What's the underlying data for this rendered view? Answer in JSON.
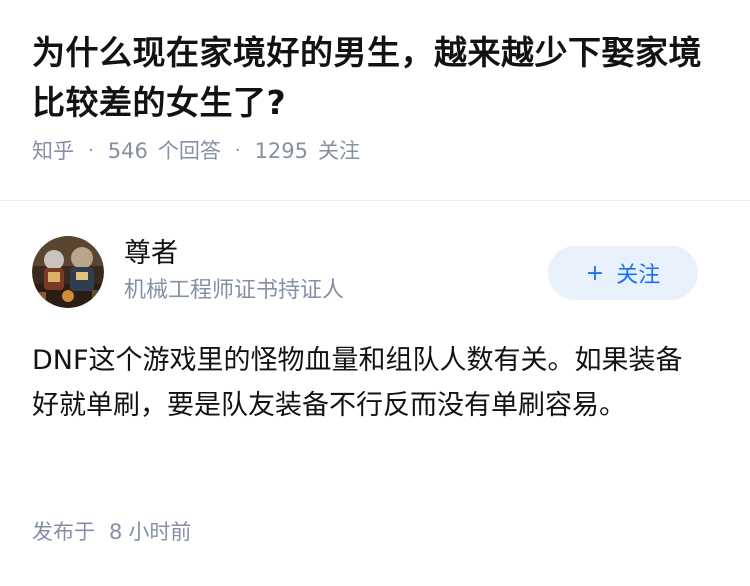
{
  "question": {
    "title": "为什么现在家境好的男生，越来越少下娶家境比较差的女生了?",
    "source": "知乎",
    "answer_count": "546",
    "answer_unit": "个回答",
    "follower_count": "1295",
    "follower_unit": "关注"
  },
  "answer": {
    "author": {
      "name": "尊者",
      "badge": "机械工程师证书持证人",
      "avatar_icon": "avatar-image"
    },
    "follow_button": {
      "plus": "+",
      "label": "关注"
    },
    "content": "DNF这个游戏里的怪物血量和组队人数有关。如果装备好就单刷，要是队友装备不行反而没有单刷容易。",
    "published_prefix": "发布于",
    "published_num": "8",
    "published_unit": "小时前"
  },
  "colors": {
    "title": "#121212",
    "meta": "#8590a6",
    "accent": "#1772f6",
    "follow_bg": "#e8f1fb"
  }
}
